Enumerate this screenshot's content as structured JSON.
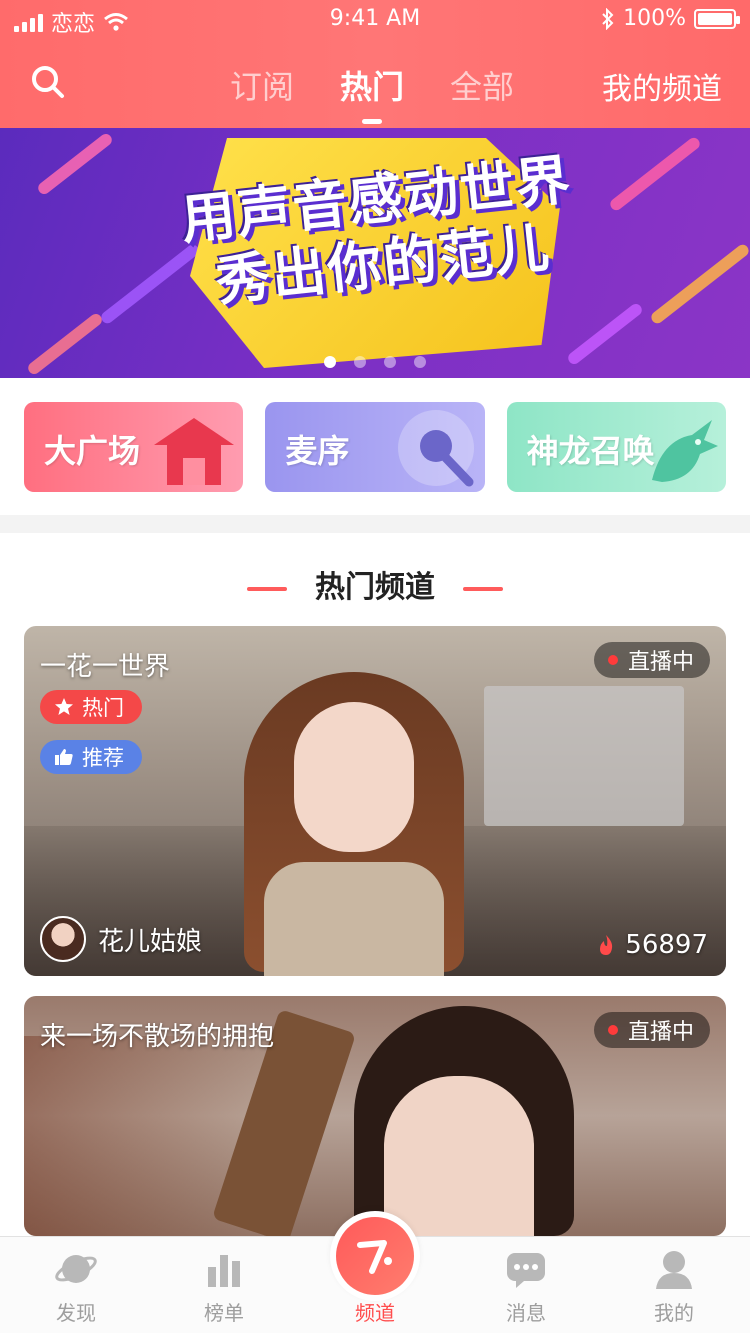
{
  "status_bar": {
    "carrier": "恋恋",
    "time": "9:41 AM",
    "battery": "100%"
  },
  "nav": {
    "tabs": [
      {
        "label": "订阅"
      },
      {
        "label": "热门"
      },
      {
        "label": "全部"
      }
    ],
    "active_tab": "热门",
    "right_label": "我的频道"
  },
  "banner": {
    "line1": "用声音感动世界",
    "line2": "秀出你的范儿",
    "page_count": 4,
    "active_index": 0
  },
  "categories": [
    {
      "label": "大广场"
    },
    {
      "label": "麦序"
    },
    {
      "label": "神龙召唤"
    }
  ],
  "section": {
    "title": "热门频道"
  },
  "channels": [
    {
      "title": "一花一世界",
      "status": "直播中",
      "badges": [
        {
          "label": "热门"
        },
        {
          "label": "推荐"
        }
      ],
      "owner": "花儿姑娘",
      "heat": "56897"
    },
    {
      "title": "来一场不散场的拥抱",
      "status": "直播中"
    }
  ],
  "tabbar": {
    "items": [
      {
        "label": "发现"
      },
      {
        "label": "榜单"
      },
      {
        "label": "频道"
      },
      {
        "label": "消息"
      },
      {
        "label": "我的"
      }
    ],
    "active": "频道"
  },
  "colors": {
    "primary": "#ff6b6b",
    "active_tab": "#ff4d4d",
    "live_dot": "#ff3b3b",
    "hot_badge": "#f44848",
    "recommend_badge": "#5a82e6"
  }
}
